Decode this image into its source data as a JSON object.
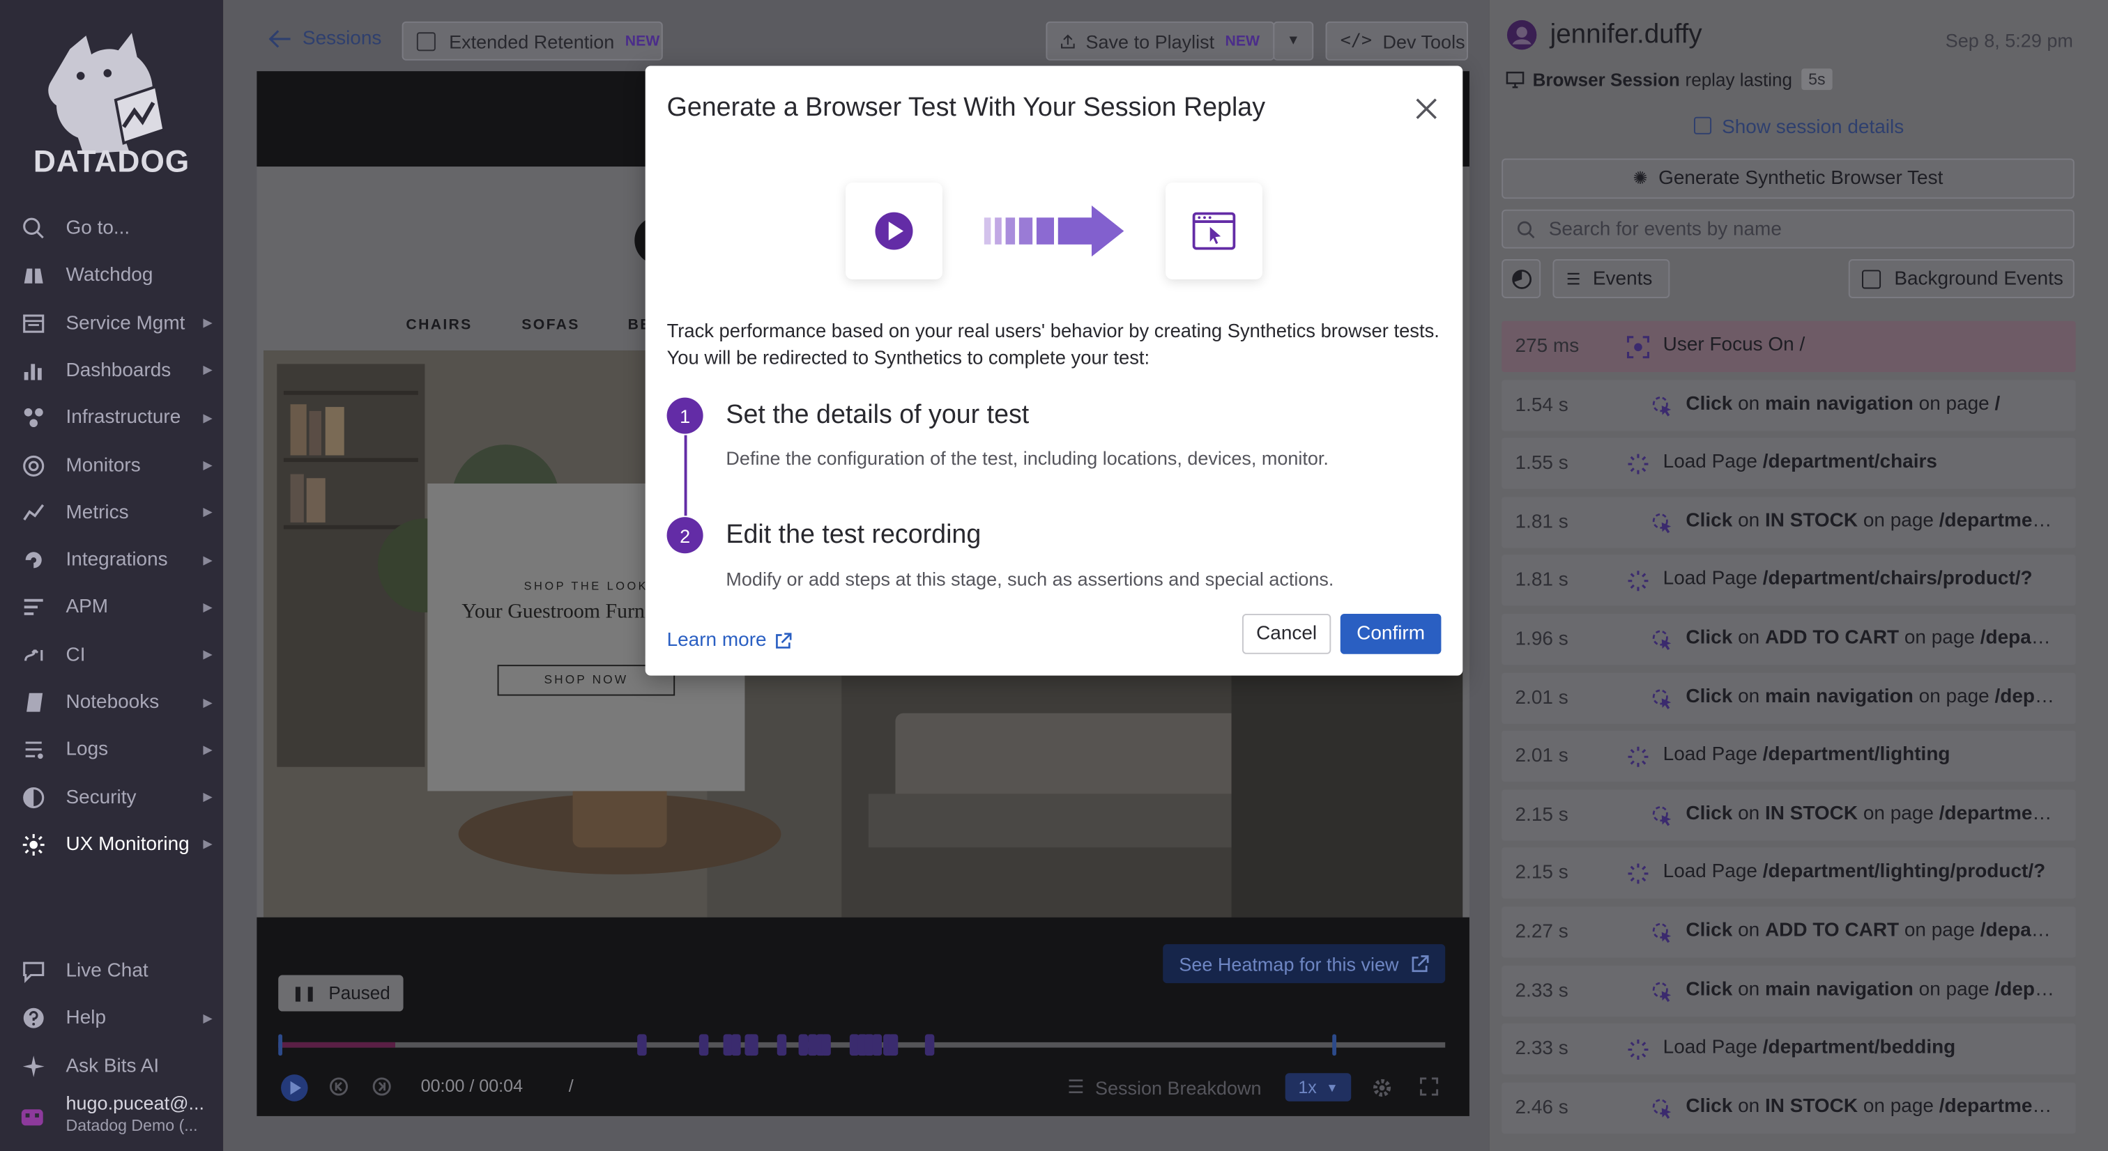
{
  "sidebar": {
    "brand": "DATADOG",
    "items": [
      {
        "label": "Go to...",
        "icon": "search-icon"
      },
      {
        "label": "Watchdog",
        "icon": "binoculars-icon"
      },
      {
        "label": "Service Mgmt",
        "icon": "service-icon"
      },
      {
        "label": "Dashboards",
        "icon": "dashboard-icon"
      },
      {
        "label": "Infrastructure",
        "icon": "infrastructure-icon"
      },
      {
        "label": "Monitors",
        "icon": "monitor-icon"
      },
      {
        "label": "Metrics",
        "icon": "metrics-icon"
      },
      {
        "label": "Integrations",
        "icon": "integrations-icon"
      },
      {
        "label": "APM",
        "icon": "apm-icon"
      },
      {
        "label": "CI",
        "icon": "ci-icon"
      },
      {
        "label": "Notebooks",
        "icon": "notebook-icon"
      },
      {
        "label": "Logs",
        "icon": "logs-icon"
      },
      {
        "label": "Security",
        "icon": "shield-icon"
      },
      {
        "label": "UX Monitoring",
        "icon": "ux-icon"
      }
    ],
    "bottom": [
      {
        "label": "Live Chat",
        "icon": "chat-icon"
      },
      {
        "label": "Help",
        "icon": "help-icon"
      },
      {
        "label": "Ask Bits AI",
        "icon": "sparkle-icon"
      }
    ],
    "user_name": "hugo.puceat@...",
    "user_org": "Datadog Demo (..."
  },
  "topbar": {
    "back_label": "Sessions",
    "retention_label": "Extended Retention",
    "retention_badge": "NEW",
    "playlist_label": "Save to Playlist",
    "playlist_badge": "NEW",
    "devtools_label": "Dev Tools"
  },
  "replay": {
    "categories": [
      "CHAIRS",
      "SOFAS",
      "BE"
    ],
    "card_kicker": "SHOP THE LOOK",
    "card_title": "Your Guestroom Furni Budget",
    "card_button": "SHOP NOW",
    "heatmap_label": "See Heatmap for this view",
    "paused_label": "Paused",
    "time": "00:00 / 00:04",
    "slash": "/",
    "breakdown_label": "Session Breakdown",
    "speed": "1x",
    "progress": 0.1
  },
  "right": {
    "user": "jennifer.duffy",
    "date": "Sep 8, 5:29 pm",
    "replay_type": "Browser Session",
    "replay_text": "replay lasting",
    "duration": "5s",
    "show_details": "Show session details",
    "generate_label": "Generate Synthetic Browser Test",
    "search_placeholder": "Search for events by name",
    "events_filter": "Events",
    "background_events": "Background Events",
    "events": [
      {
        "time": "275 ms",
        "kind": "focus",
        "action": "User Focus On /",
        "target": "",
        "suffix": "",
        "page": ""
      },
      {
        "time": "1.54 s",
        "kind": "click",
        "action": "Click",
        "target": "main navigation",
        "suffix": "on page",
        "page": "/"
      },
      {
        "time": "1.55 s",
        "kind": "load",
        "action": "Load Page",
        "target": "",
        "suffix": "",
        "page": "/department/chairs"
      },
      {
        "time": "1.81 s",
        "kind": "click",
        "action": "Click",
        "target": "IN STOCK",
        "suffix": "on page",
        "page": "/department..."
      },
      {
        "time": "1.81 s",
        "kind": "load",
        "action": "Load Page",
        "target": "",
        "suffix": "",
        "page": "/department/chairs/product/?"
      },
      {
        "time": "1.96 s",
        "kind": "click",
        "action": "Click",
        "target": "ADD TO CART",
        "suffix": "on page",
        "page": "/depart..."
      },
      {
        "time": "2.01 s",
        "kind": "click",
        "action": "Click",
        "target": "main navigation",
        "suffix": "on page",
        "page": "/depa..."
      },
      {
        "time": "2.01 s",
        "kind": "load",
        "action": "Load Page",
        "target": "",
        "suffix": "",
        "page": "/department/lighting"
      },
      {
        "time": "2.15 s",
        "kind": "click",
        "action": "Click",
        "target": "IN STOCK",
        "suffix": "on page",
        "page": "/department..."
      },
      {
        "time": "2.15 s",
        "kind": "load",
        "action": "Load Page",
        "target": "",
        "suffix": "",
        "page": "/department/lighting/product/?"
      },
      {
        "time": "2.27 s",
        "kind": "click",
        "action": "Click",
        "target": "ADD TO CART",
        "suffix": "on page",
        "page": "/depart..."
      },
      {
        "time": "2.33 s",
        "kind": "click",
        "action": "Click",
        "target": "main navigation",
        "suffix": "on page",
        "page": "/depa..."
      },
      {
        "time": "2.33 s",
        "kind": "load",
        "action": "Load Page",
        "target": "",
        "suffix": "",
        "page": "/department/bedding"
      },
      {
        "time": "2.46 s",
        "kind": "click",
        "action": "Click",
        "target": "IN STOCK",
        "suffix": "on page",
        "page": "/department..."
      }
    ]
  },
  "modal": {
    "title": "Generate a Browser Test With Your Session Replay",
    "description": "Track performance based on your real users' behavior by creating Synthetics browser tests. You will be redirected to Synthetics to complete your test:",
    "steps": [
      {
        "number": "1",
        "title": "Set the details of your test",
        "desc": "Define the configuration of the test, including locations, devices, monitor."
      },
      {
        "number": "2",
        "title": "Edit the test recording",
        "desc": "Modify or add steps at this stage, such as assertions and special actions."
      }
    ],
    "learn_more": "Learn more",
    "cancel": "Cancel",
    "confirm": "Confirm",
    "accent": "#632ca6",
    "primary": "#2a5fc2"
  }
}
